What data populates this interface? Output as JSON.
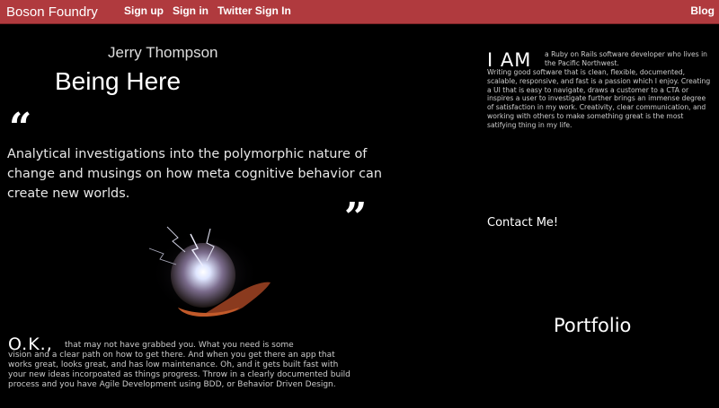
{
  "navbar": {
    "brand": "Boson Foundry",
    "links": [
      "Sign up",
      "Sign in",
      "Twitter Sign In"
    ],
    "right_link": "Blog",
    "bg_color": "#b03a3e"
  },
  "hero": {
    "author": "Jerry Thompson",
    "title": "Being Here",
    "quote_open": "“",
    "quote_close": "”",
    "quote": "Analytical investigations into the polymorphic nature of change and musings on how meta cognitive behavior can create new worlds.",
    "image": "crystal-ball-hand-lightning"
  },
  "ok_section": {
    "heading": "O.K.,",
    "first_line": "that may not have grabbed you. What you need is some",
    "text": "vision and a clear path on how to get there. And when you get there an app that works great, looks great, and has low maintenance. Oh, and it gets built fast with your new ideas incorpoated as things progress. Throw in a clearly documented build process and you have Agile Development using BDD, or Behavior Driven Design."
  },
  "about": {
    "heading": "I AM",
    "first_line": "a Ruby on Rails software developer who lives in the Pacific Northwest.",
    "text": "Writing good software that is clean, flexible, documented, scalable, responsive, and fast is a passion which I enjoy. Creating a UI that is easy to navigate, draws a customer to a CTA or inspires a user to investigate further brings an immense degree of satisfaction in my work. Creativity, clear communication, and working with others to make something great is the most satifying thing in my life."
  },
  "contact_label": "Contact Me!",
  "portfolio_label": "Portfolio"
}
